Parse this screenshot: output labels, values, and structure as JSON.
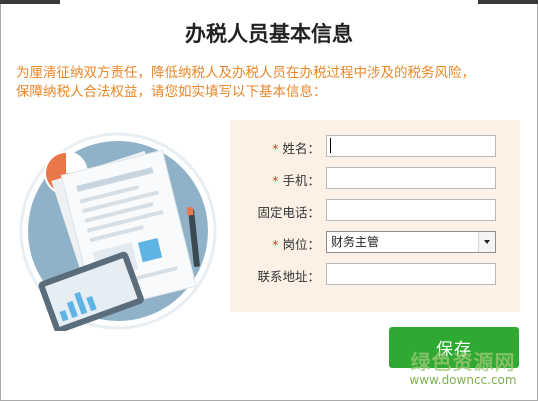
{
  "window": {
    "title": "办税人员基本信息"
  },
  "intro": {
    "line1": "为厘清征纳双方责任，降低纳税人及办税人员在办税过程中涉及的税务风险，",
    "line2": "保障纳税人合法权益，请您如实填写以下基本信息："
  },
  "form": {
    "required_mark": "*",
    "name": {
      "label": "姓名：",
      "value": ""
    },
    "phone": {
      "label": "手机：",
      "value": ""
    },
    "landline": {
      "label": "固定电话：",
      "value": ""
    },
    "position": {
      "label": "岗位：",
      "selected": "财务主管"
    },
    "address": {
      "label": "联系地址：",
      "value": ""
    }
  },
  "actions": {
    "save_label": "保存"
  },
  "watermark": {
    "text": "绿色资源网",
    "url": "www.downcc.com"
  },
  "colors": {
    "intro_text": "#e8872a",
    "panel_bg": "#fdf1e6",
    "required": "#e23b2e",
    "save_button": "#2eaa33"
  },
  "icons": {
    "illustration": "document-report-illustration"
  }
}
